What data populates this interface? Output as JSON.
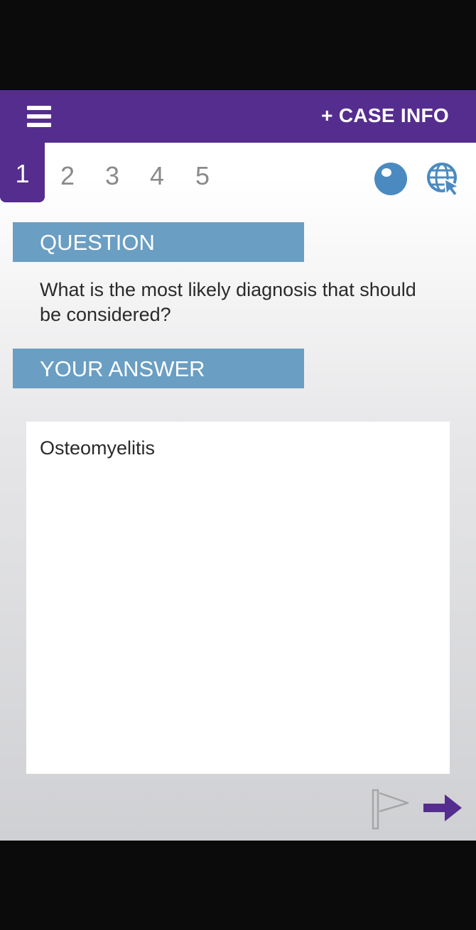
{
  "header": {
    "menu_icon": "hamburger-menu-icon",
    "case_info_label": "+ CASE INFO",
    "background_color": "#552d8e"
  },
  "tabs": [
    {
      "label": "1",
      "active": true
    },
    {
      "label": "2",
      "active": false
    },
    {
      "label": "3",
      "active": false
    },
    {
      "label": "4",
      "active": false
    },
    {
      "label": "5",
      "active": false
    }
  ],
  "toolbar_icons": [
    "search-lens-icon",
    "web-globe-icon"
  ],
  "question": {
    "header": "QUESTION",
    "text": "What is the most likely diagnosis that should be considered?"
  },
  "answer": {
    "header": "YOUR ANSWER",
    "value": "Osteomyelitis"
  },
  "footer": {
    "flag_icon": "flag-icon",
    "next_icon": "next-arrow-icon"
  },
  "colors": {
    "accent": "#552d8e",
    "section_header": "#6a9ec3",
    "icon_blue": "#4a8ac0"
  }
}
